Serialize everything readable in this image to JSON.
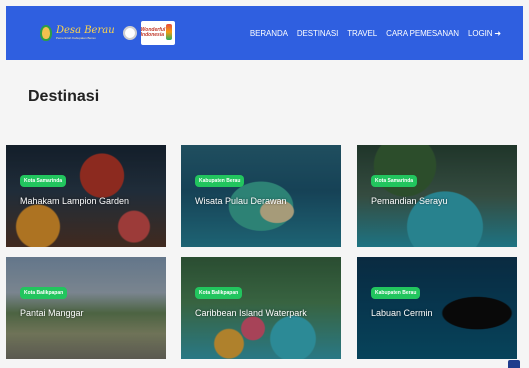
{
  "brand": {
    "script_text": "Desa Berau",
    "subtitle": "Pemerintah Kabupaten Berau",
    "partner_text": "Wonderful Indonesia"
  },
  "nav": {
    "items": [
      "BERANDA",
      "DESTINASI",
      "TRAVEL",
      "CARA PEMESANAN",
      "LOGIN"
    ],
    "login_icon": "sign-in-icon"
  },
  "page": {
    "heading": "Destinasi"
  },
  "destinations": [
    {
      "badge": "Kota Samarinda",
      "title": "Mahakam Lampion Garden"
    },
    {
      "badge": "Kabupaten Berau",
      "title": "Wisata Pulau Derawan"
    },
    {
      "badge": "Kota Samarinda",
      "title": "Pemandian Serayu"
    },
    {
      "badge": "Kota Balikpapan",
      "title": "Pantai Manggar"
    },
    {
      "badge": "Kota Balikpapan",
      "title": "Caribbean Island Waterpark"
    },
    {
      "badge": "Kabupaten Berau",
      "title": "Labuan Cermin"
    }
  ],
  "colors": {
    "navbar": "#2f5fe0",
    "badge": "#22c55e",
    "accent_button": "#1f3c8c"
  }
}
